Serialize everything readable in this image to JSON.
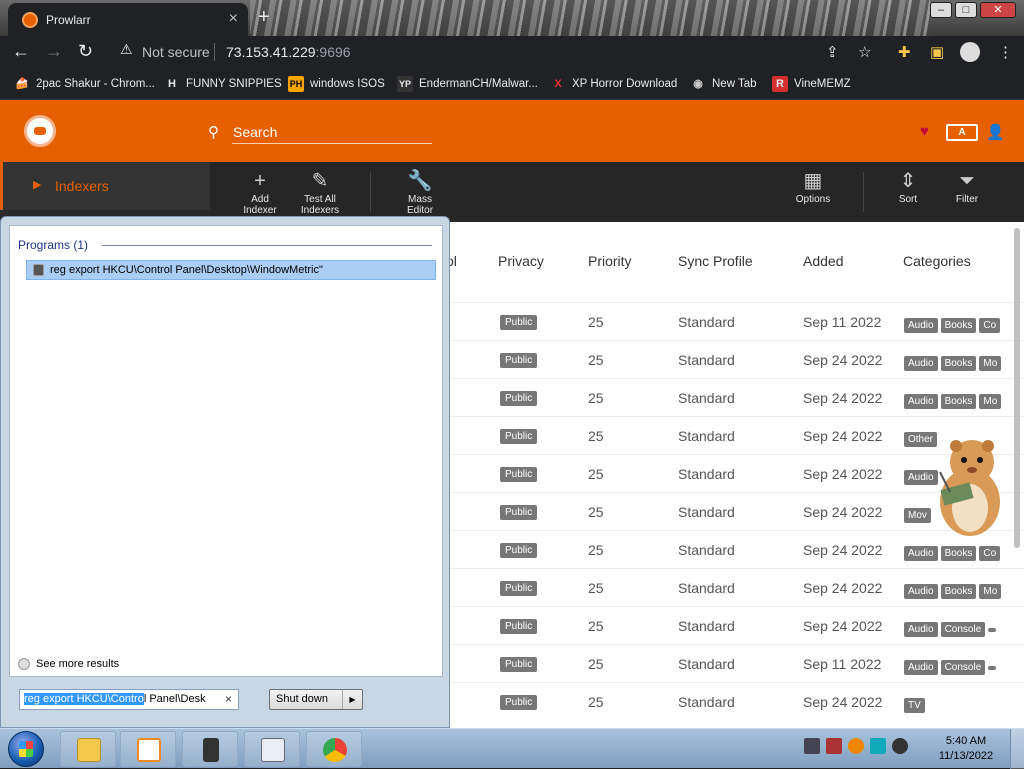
{
  "browser": {
    "tab_title": "Prowlarr",
    "security_label": "Not secure",
    "url_host": "73.153.41.229",
    "url_port": ":9696"
  },
  "bookmarks": [
    {
      "label": "2pac Shakur - Chrom...",
      "icon": "🍰",
      "color": "#202124"
    },
    {
      "label": "FUNNY SNIPPIES",
      "icon": "H",
      "color": "#202124"
    },
    {
      "label": "windows ISOS",
      "icon": "PH",
      "color": "#f7a400"
    },
    {
      "label": "EndermanCH/Malwar...",
      "icon": "YP",
      "color": "#333"
    },
    {
      "label": "XP Horror Download",
      "icon": "X",
      "color": "#202124"
    },
    {
      "label": "New Tab",
      "icon": "◉",
      "color": "#202124"
    },
    {
      "label": "VineMEMZ",
      "icon": "R",
      "color": "#d32f2f"
    }
  ],
  "app": {
    "search_placeholder": "Search",
    "lang_badge": "A",
    "sidebar_active": "Indexers",
    "toolbar": {
      "add": "Add\nIndexer",
      "test": "Test All\nIndexers",
      "mass": "Mass\nEditor",
      "options": "Options",
      "sort": "Sort",
      "filter": "Filter"
    },
    "columns": {
      "protocol": "ol",
      "privacy": "Privacy",
      "priority": "Priority",
      "sync": "Sync Profile",
      "added": "Added",
      "categories": "Categories"
    },
    "rows": [
      {
        "privacy": "Public",
        "priority": "25",
        "sync": "Standard",
        "added": "Sep 11 2022",
        "tags": [
          "Audio",
          "Books",
          "Co"
        ]
      },
      {
        "privacy": "Public",
        "priority": "25",
        "sync": "Standard",
        "added": "Sep 24 2022",
        "tags": [
          "Audio",
          "Books",
          "Mo"
        ]
      },
      {
        "privacy": "Public",
        "priority": "25",
        "sync": "Standard",
        "added": "Sep 24 2022",
        "tags": [
          "Audio",
          "Books",
          "Mo"
        ]
      },
      {
        "privacy": "Public",
        "priority": "25",
        "sync": "Standard",
        "added": "Sep 24 2022",
        "tags": [
          "Other"
        ]
      },
      {
        "privacy": "Public",
        "priority": "25",
        "sync": "Standard",
        "added": "Sep 24 2022",
        "tags": [
          "Audio"
        ]
      },
      {
        "privacy": "Public",
        "priority": "25",
        "sync": "Standard",
        "added": "Sep 24 2022",
        "tags": [
          "Mov"
        ]
      },
      {
        "privacy": "Public",
        "priority": "25",
        "sync": "Standard",
        "added": "Sep 24 2022",
        "tags": [
          "Audio",
          "Books",
          "Co"
        ]
      },
      {
        "privacy": "Public",
        "priority": "25",
        "sync": "Standard",
        "added": "Sep 24 2022",
        "tags": [
          "Audio",
          "Books",
          "Mo"
        ]
      },
      {
        "privacy": "Public",
        "priority": "25",
        "sync": "Standard",
        "added": "Sep 24 2022",
        "tags": [
          "Audio",
          "Console",
          ""
        ]
      },
      {
        "privacy": "Public",
        "priority": "25",
        "sync": "Standard",
        "added": "Sep 11 2022",
        "tags": [
          "Audio",
          "Console",
          ""
        ]
      },
      {
        "privacy": "Public",
        "priority": "25",
        "sync": "Standard",
        "added": "Sep 24 2022",
        "tags": [
          "TV"
        ]
      }
    ]
  },
  "start_menu": {
    "programs_header": "Programs (1)",
    "program_item": "reg export HKCU\\Control Panel\\Desktop\\WindowMetric\"",
    "see_more": "See more results",
    "search_selected": "reg export HKCU\\Contro",
    "search_rest": "l Panel\\Desk",
    "shutdown_label": "Shut down"
  },
  "taskbar": {
    "time": "5:40 AM",
    "date": "11/13/2022"
  },
  "colors": {
    "accent": "#e66000",
    "tag": "#777777"
  }
}
